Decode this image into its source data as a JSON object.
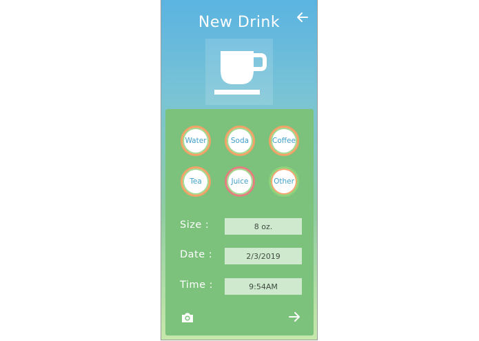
{
  "header": {
    "title": "New Drink",
    "back_icon": "arrow-left-icon"
  },
  "hero": {
    "icon": "coffee-cup-icon"
  },
  "drinks": [
    {
      "label": "Water",
      "ring": "orange"
    },
    {
      "label": "Soda",
      "ring": "orange"
    },
    {
      "label": "Coffee",
      "ring": "orange"
    },
    {
      "label": "Tea",
      "ring": "orange"
    },
    {
      "label": "Juice",
      "ring": "red"
    },
    {
      "label": "Other",
      "ring": "green"
    }
  ],
  "fields": {
    "size": {
      "label": "Size :",
      "value": "8 oz."
    },
    "date": {
      "label": "Date :",
      "value": "2/3/2019"
    },
    "time": {
      "label": "Time :",
      "value": "9:54AM"
    }
  },
  "footer": {
    "camera_icon": "camera-icon",
    "next_icon": "arrow-right-icon"
  },
  "colors": {
    "gradient_top": "#5ab3e0",
    "gradient_bottom": "#c7e8ab",
    "panel": "#7cc17c",
    "field_bg": "#cfe9cf",
    "drink_text": "#3e9fc9",
    "ring_orange": "#f3a268",
    "ring_green": "#8fd27c",
    "ring_red": "#e57f7f"
  }
}
